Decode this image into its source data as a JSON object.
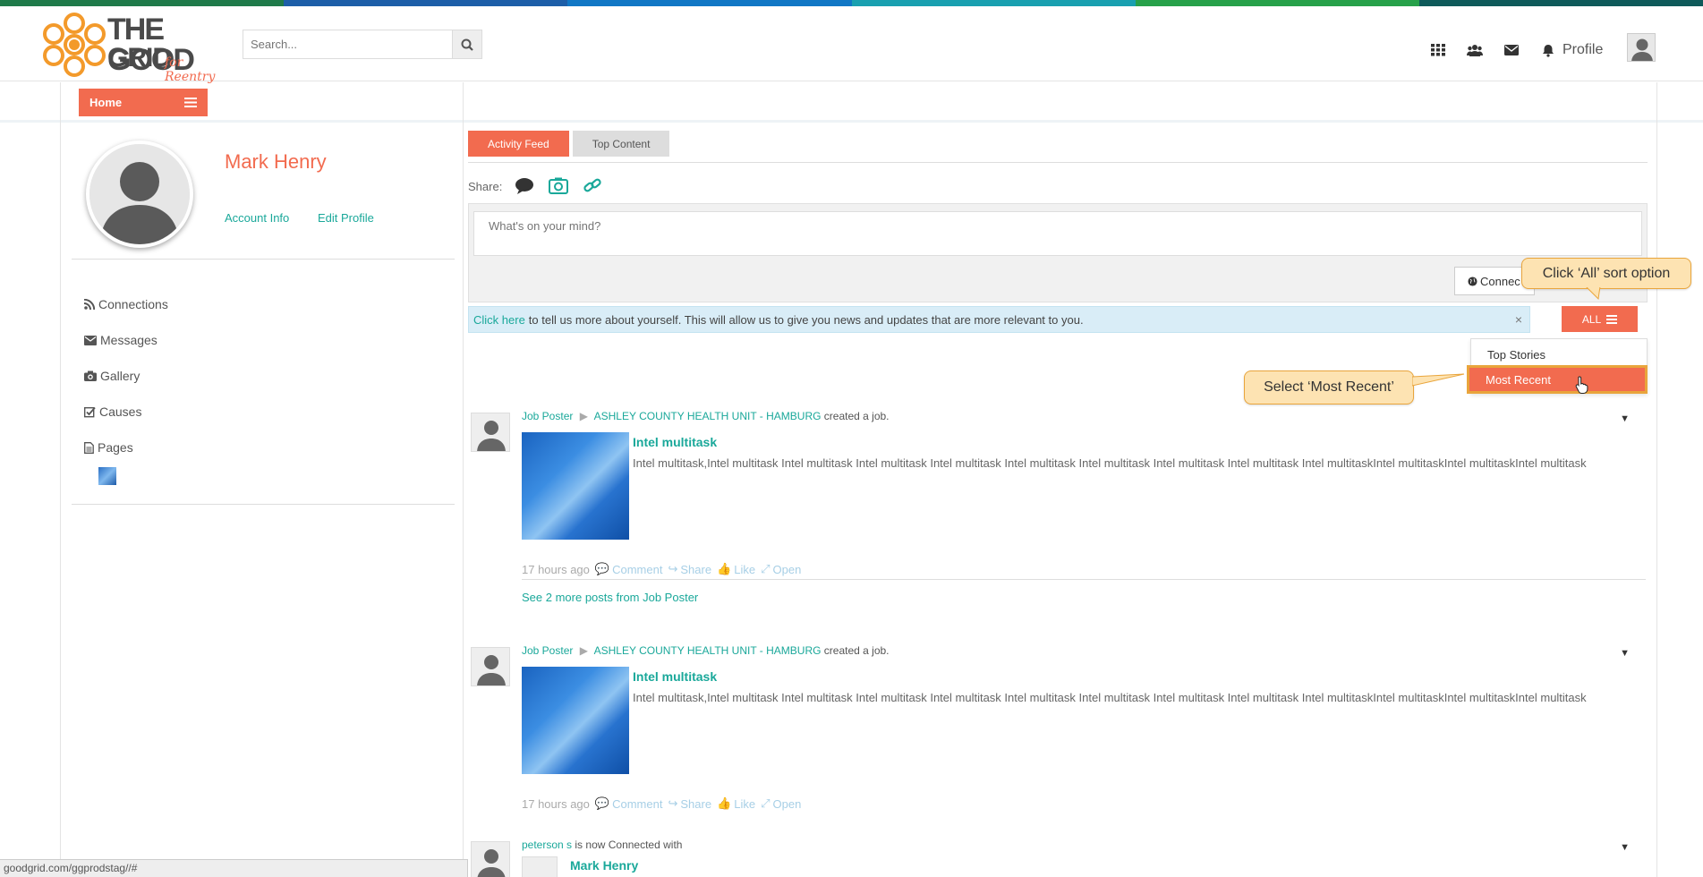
{
  "colors": {
    "accent": "#f26b4f",
    "link": "#1aa89a",
    "callout_bg": "#fde3b2",
    "callout_border": "#e9a53c",
    "stripe": [
      "#1f7a4a",
      "#1d5ea8",
      "#1177c5",
      "#19a0b0",
      "#27a14a",
      "#0e5a5a"
    ]
  },
  "header": {
    "logo": {
      "word1": "THE GOOD",
      "word2": "GRID",
      "script": "for Reentry"
    },
    "search": {
      "placeholder": "Search...",
      "icon": "search-icon"
    },
    "nav_icons": [
      "apps-grid-icon",
      "users-icon",
      "envelope-icon",
      "bell-icon"
    ],
    "profile_label": "Profile"
  },
  "subbar": {
    "home_label": "Home"
  },
  "sidebar": {
    "user_name": "Mark Henry",
    "account_info": "Account Info",
    "edit_profile": "Edit Profile",
    "menu": [
      {
        "label": "Connections",
        "icon": "rss-icon"
      },
      {
        "label": "Messages",
        "icon": "envelope-icon"
      },
      {
        "label": "Gallery",
        "icon": "camera-icon"
      },
      {
        "label": "Causes",
        "icon": "checkbox-icon"
      },
      {
        "label": "Pages",
        "icon": "file-icon"
      }
    ]
  },
  "main": {
    "tabs": [
      {
        "label": "Activity Feed",
        "active": true
      },
      {
        "label": "Top Content",
        "active": false
      }
    ],
    "share_label": "Share:",
    "compose_placeholder": "What's on your mind?",
    "connect_button": "Connec",
    "alert": {
      "link": "Click here",
      "text": "to tell us more about yourself. This will allow us to give you news and updates that are more relevant to you.",
      "close": "×"
    },
    "all_button": "ALL",
    "sort_options": [
      "Top Stories",
      "Most Recent"
    ],
    "callouts": {
      "all": "Click ‘All’ sort option",
      "most_recent": "Select ‘Most Recent’"
    },
    "posts": [
      {
        "author": "Job Poster",
        "target": "ASHLEY COUNTY HEALTH UNIT - HAMBURG",
        "action": "created a job.",
        "headline": "Intel multitask",
        "body": "Intel multitask,Intel multitask Intel multitask Intel multitask Intel multitask Intel multitask Intel multitask Intel multitask Intel multitask  Intel multitaskIntel multitaskIntel multitaskIntel multitask",
        "time": "17 hours ago",
        "actions": [
          "Comment",
          "Share",
          "Like",
          "Open"
        ],
        "see_more": "See 2 more posts from Job Poster"
      },
      {
        "author": "Job Poster",
        "target": "ASHLEY COUNTY HEALTH UNIT - HAMBURG",
        "action": "created a job.",
        "headline": "Intel multitask",
        "body": "Intel multitask,Intel multitask Intel multitask Intel multitask Intel multitask Intel multitask Intel multitask Intel multitask Intel multitask  Intel multitaskIntel multitaskIntel multitaskIntel multitask",
        "time": "17 hours ago",
        "actions": [
          "Comment",
          "Share",
          "Like",
          "Open"
        ]
      },
      {
        "author": "peterson s",
        "action": "is now Connected with",
        "headline": "Mark Henry"
      }
    ]
  },
  "statusbar": {
    "url": "goodgrid.com/ggprodstag//#"
  }
}
